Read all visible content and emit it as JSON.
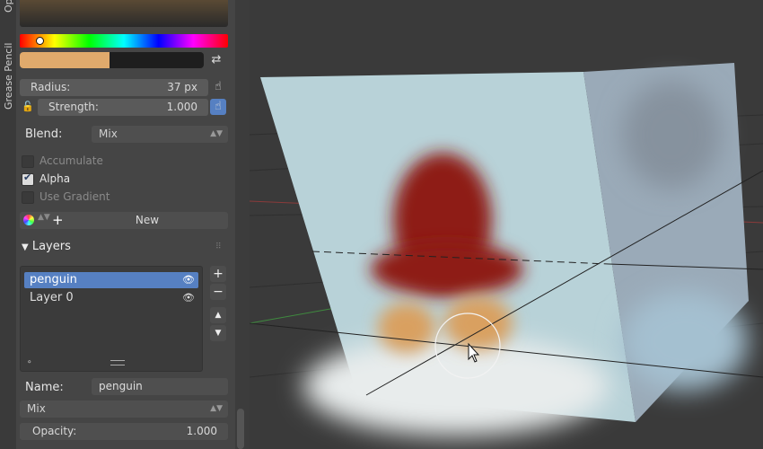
{
  "side_tabs": [
    "Op",
    "Grease Pencil"
  ],
  "colors": {
    "swatch": "#e0aa6c",
    "selected_layer": "#5680c2"
  },
  "brush": {
    "radius_label": "Radius:",
    "radius_value": "37 px",
    "strength_label": "Strength:",
    "strength_value": "1.000",
    "blend_label": "Blend:",
    "blend_value": "Mix"
  },
  "options": {
    "accumulate": "Accumulate",
    "alpha": "Alpha",
    "use_gradient": "Use Gradient"
  },
  "new_label": "New",
  "layers": {
    "title": "Layers",
    "items": [
      {
        "name": "penguin",
        "selected": true
      },
      {
        "name": "Layer 0",
        "selected": false
      }
    ]
  },
  "layer_props": {
    "name_label": "Name:",
    "name_value": "penguin",
    "blend_mode": "Mix",
    "opacity_label": "Opacity:",
    "opacity_value": "1.000"
  }
}
